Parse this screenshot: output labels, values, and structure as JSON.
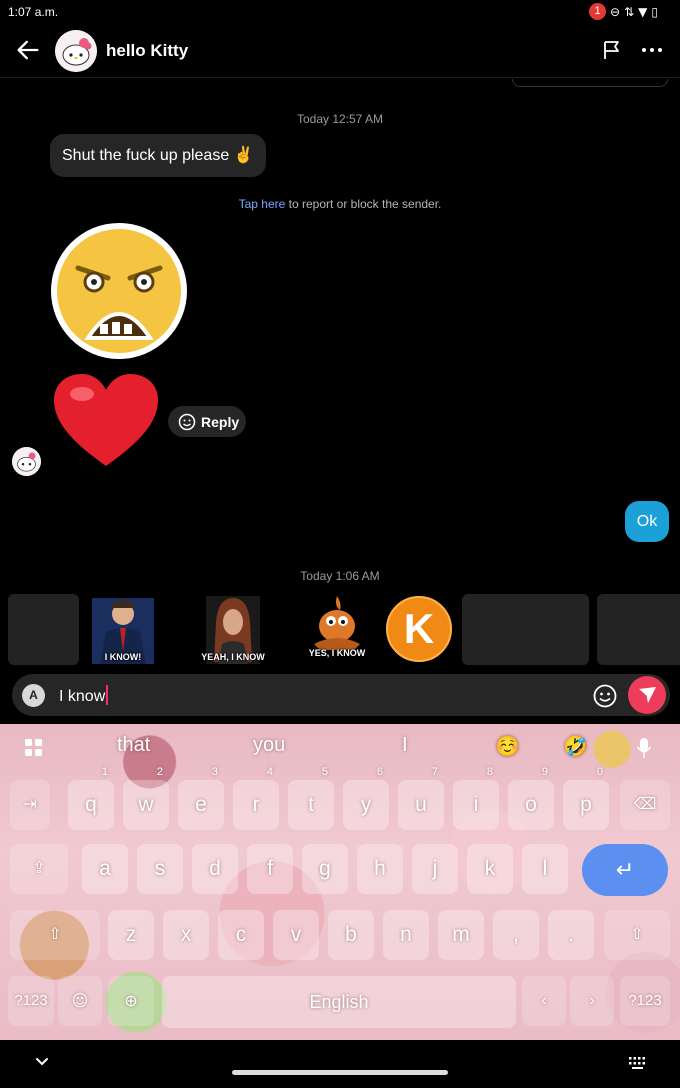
{
  "status_bar": {
    "time": "1:07 a.m.",
    "notification_count": "1"
  },
  "header": {
    "contact_name": "hello Kitty"
  },
  "chat": {
    "timestamp_1": "Today 12:57 AM",
    "incoming_message": "Shut the fuck up please ✌️",
    "report_link": "Tap here",
    "report_text": " to report or block the sender.",
    "reply_label": "Reply",
    "outgoing_message": "Ok",
    "timestamp_2": "Today 1:06 AM"
  },
  "sticker_suggestions": [
    {
      "caption": "I KNOW!"
    },
    {
      "caption": "YEAH, I KNOW"
    },
    {
      "caption": "YES, I KNOW"
    },
    {
      "caption": "K"
    }
  ],
  "compose": {
    "keyboard_toggle": "A",
    "text": "I know"
  },
  "keyboard": {
    "suggestions": [
      "that",
      "you",
      "I",
      "☺️",
      "🤣"
    ],
    "row1": [
      "q",
      "w",
      "e",
      "r",
      "t",
      "y",
      "u",
      "i",
      "o",
      "p"
    ],
    "row1_hints": [
      "1",
      "2",
      "3",
      "4",
      "5",
      "6",
      "7",
      "8",
      "9",
      "0"
    ],
    "row2": [
      "a",
      "s",
      "d",
      "f",
      "g",
      "h",
      "j",
      "k",
      "l"
    ],
    "row3": [
      "z",
      "x",
      "c",
      "v",
      "b",
      "n",
      "m",
      ",",
      "."
    ],
    "symbols_left": "?123",
    "symbols_right": "?123",
    "space_label": "English",
    "enter_symbol": "↵"
  },
  "colors": {
    "outgoing_bubble": "#1ba0d8",
    "send_button": "#ee3d5b",
    "enter_key": "#5b8ff0",
    "link": "#7aa7ff"
  }
}
